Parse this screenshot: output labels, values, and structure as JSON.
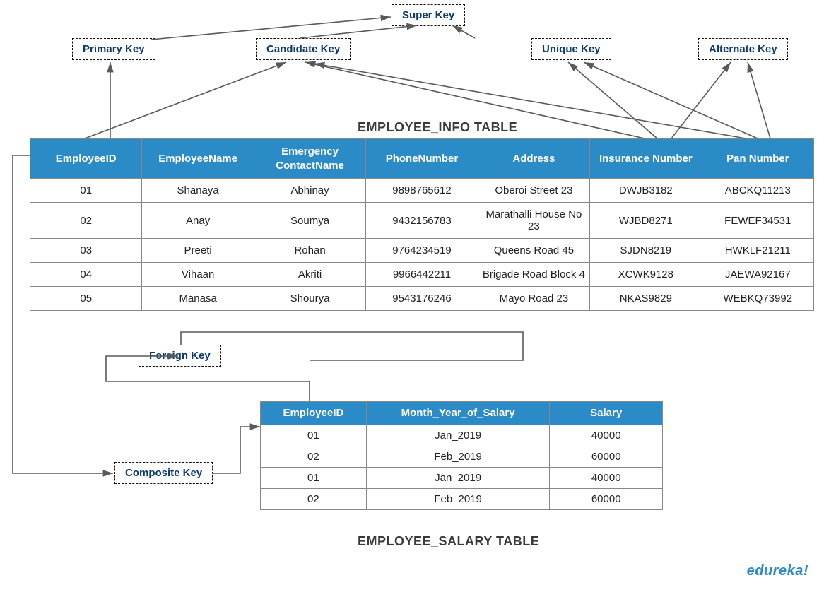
{
  "keys": {
    "super": "Super Key",
    "primary": "Primary Key",
    "candidate": "Candidate Key",
    "unique": "Unique Key",
    "alternate": "Alternate Key",
    "foreign": "Foreign Key",
    "composite": "Composite Key"
  },
  "table1": {
    "title": "EMPLOYEE_INFO TABLE",
    "headers": {
      "c0": "EmployeeID",
      "c1": "EmployeeName",
      "c2": "Emergency ContactName",
      "c3": "PhoneNumber",
      "c4": "Address",
      "c5": "Insurance Number",
      "c6": "Pan Number"
    },
    "rows": [
      {
        "c0": "01",
        "c1": "Shanaya",
        "c2": "Abhinay",
        "c3": "9898765612",
        "c4": "Oberoi Street 23",
        "c5": "DWJB3182",
        "c6": "ABCKQ11213"
      },
      {
        "c0": "02",
        "c1": "Anay",
        "c2": "Soumya",
        "c3": "9432156783",
        "c4": "Marathalli House No 23",
        "c5": "WJBD8271",
        "c6": "FEWEF34531"
      },
      {
        "c0": "03",
        "c1": "Preeti",
        "c2": "Rohan",
        "c3": "9764234519",
        "c4": "Queens Road 45",
        "c5": "SJDN8219",
        "c6": "HWKLF21211"
      },
      {
        "c0": "04",
        "c1": "Vihaan",
        "c2": "Akriti",
        "c3": "9966442211",
        "c4": "Brigade Road Block 4",
        "c5": "XCWK9128",
        "c6": "JAEWA92167"
      },
      {
        "c0": "05",
        "c1": "Manasa",
        "c2": "Shourya",
        "c3": "9543176246",
        "c4": "Mayo Road 23",
        "c5": "NKAS9829",
        "c6": "WEBKQ73992"
      }
    ]
  },
  "table2": {
    "title": "EMPLOYEE_SALARY TABLE",
    "headers": {
      "c0": "EmployeeID",
      "c1": "Month_Year_of_Salary",
      "c2": "Salary"
    },
    "rows": [
      {
        "c0": "01",
        "c1": "Jan_2019",
        "c2": "40000"
      },
      {
        "c0": "02",
        "c1": "Feb_2019",
        "c2": "60000"
      },
      {
        "c0": "01",
        "c1": "Jan_2019",
        "c2": "40000"
      },
      {
        "c0": "02",
        "c1": "Feb_2019",
        "c2": "60000"
      }
    ]
  },
  "brand": "edureka!"
}
